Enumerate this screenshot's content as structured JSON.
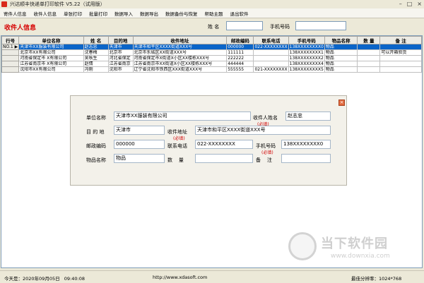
{
  "window": {
    "title": "兴达顺丰快递单打印软件 V5.22（试用版）"
  },
  "menu": {
    "items": [
      "寄件人信息",
      "收件人信息",
      "单张打印",
      "批量打印",
      "数据导入",
      "数据导出",
      "数据备份与恢复",
      "帮助主题",
      "退出软件"
    ]
  },
  "header": {
    "title": "收件人信息",
    "name_label": "姓  名",
    "phone_label": "手机号码"
  },
  "table": {
    "columns": [
      "行号",
      "单位名称",
      "姓 名",
      "目的地",
      "收件地址",
      "邮政编码",
      "联系电话",
      "手机号码",
      "物品名称",
      "数 量",
      "备 注"
    ],
    "rows": [
      [
        "NO.1 ▶",
        "天津市XX服装有限公司",
        "赵志忠",
        "天津市",
        "天津市和平区XXXX街道XXX号",
        "000000",
        "022-XXXXXXXX",
        "138XXXXXXXX0",
        "物品",
        "",
        ""
      ],
      [
        "",
        "北京市XX有限公司",
        "沈春梅",
        "北京市",
        "北京市东城区XX街道XXX号",
        "111111",
        "",
        "138XXXXXXXX1",
        "物品",
        "",
        "可以开箱验货"
      ],
      [
        "",
        "河南省保定市 X有限公司",
        "吴秋生",
        "河北省保定",
        "河南省保定市X街道X小区XX楼栋XXX号",
        "222222",
        "",
        "138XXXXXXXX2",
        "物品",
        "",
        ""
      ],
      [
        "",
        "江苏省南京市 X有限公司",
        "赵情",
        "江苏省南京",
        "江苏省南京市XX街道X小区XX楼栋XXX号",
        "444444",
        "",
        "138XXXXXXXX4",
        "物品",
        "",
        ""
      ],
      [
        "",
        "沈阳市XX有限公司",
        "冯刚",
        "沈阳市",
        "辽宁省沈阳市铁西区XXX街道XXX号",
        "555555",
        "021-XXXXXXXX",
        "138XXXXXXXX5",
        "物品",
        "",
        ""
      ]
    ]
  },
  "dialog": {
    "company_label": "单位名称",
    "company_value": "天津市XX服装有限公司",
    "recipient_label": "收件人姓名",
    "recipient_value": "赵志忠",
    "recipient_req": "(必填)",
    "dest_label": "目 的 地",
    "dest_value": "天津市",
    "address_label": "收件地址",
    "address_value": "天津市和平区XXXX街道XXX号",
    "address_req": "(必填)",
    "zip_label": "邮政编码",
    "zip_value": "000000",
    "tel_label": "联系电话",
    "tel_value": "022-XXXXXXXX",
    "mobile_label": "手机号码",
    "mobile_value": "138XXXXXXXX0",
    "mobile_req": "(必填)",
    "item_label": "物品名称",
    "item_value": "物品",
    "qty_label": "数    量",
    "qty_value": "",
    "note_label": "备    注",
    "note_value": ""
  },
  "status": {
    "today": "今天是：2020年09月05日   09:40:08",
    "url": "http://www.xdasoft.com",
    "resolution": "最佳分辨率：1024*768"
  },
  "watermark": {
    "name": "当下软件园",
    "url": "www.downxia.com"
  }
}
